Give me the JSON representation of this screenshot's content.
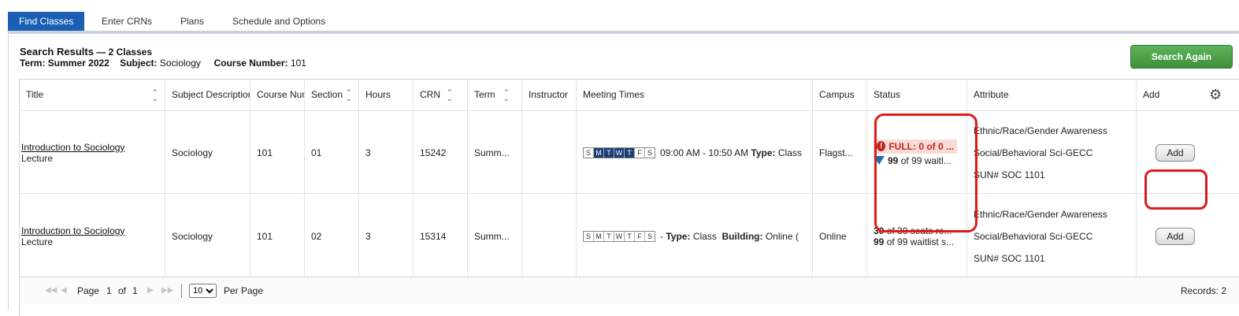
{
  "tabs": [
    "Find Classes",
    "Enter CRNs",
    "Plans",
    "Schedule and Options"
  ],
  "header": {
    "title": "Search Results",
    "count": "— 2 Classes",
    "term_label": "Term:",
    "term_value": "Summer 2022",
    "subject_label": "Subject:",
    "subject_value": "Sociology",
    "course_label": "Course Number:",
    "course_value": "101",
    "search_again": "Search Again"
  },
  "columns": [
    "Title",
    "Subject Description",
    "Course Number",
    "Section",
    "Hours",
    "CRN",
    "Term",
    "Instructor",
    "Meeting Times",
    "Campus",
    "Status",
    "Attribute",
    "Add"
  ],
  "rows": [
    {
      "title": "Introduction to Sociology",
      "type": "Lecture",
      "subject": "Sociology",
      "course": "101",
      "section": "01",
      "hours": "3",
      "crn": "15242",
      "term": "Summ...",
      "instructor": "",
      "days": [
        "S",
        "M",
        "T",
        "W",
        "T",
        "F",
        "S"
      ],
      "days_on": [
        false,
        true,
        true,
        true,
        true,
        false,
        false
      ],
      "time": "09:00 AM - 10:50 AM",
      "meet_type_label": "Type:",
      "meet_type": "Class",
      "building_label": "",
      "building": "",
      "campus": "Flagst...",
      "status_line1": "FULL: 0 of 0 ...",
      "status_line2_num": "99",
      "status_line2_rest": "of 99 waitl...",
      "attributes": [
        "Ethnic/Race/Gender Awareness",
        "Social/Behavioral Sci-GECC",
        "SUN# SOC 1101"
      ],
      "add": "Add"
    },
    {
      "title": "Introduction to Sociology",
      "type": "Lecture",
      "subject": "Sociology",
      "course": "101",
      "section": "02",
      "hours": "3",
      "crn": "15314",
      "term": "Summ...",
      "instructor": "",
      "days": [
        "S",
        "M",
        "T",
        "W",
        "T",
        "F",
        "S"
      ],
      "days_on": [
        false,
        false,
        false,
        false,
        false,
        false,
        false
      ],
      "time": "-",
      "meet_type_label": "Type:",
      "meet_type": "Class",
      "building_label": "Building:",
      "building": "Online (",
      "campus": "Online",
      "status_line1_num": "30",
      "status_line1_rest": "of 30 seats re...",
      "status_line2_num": "99",
      "status_line2_rest": "of 99 waitlist s...",
      "attributes": [
        "Ethnic/Race/Gender Awareness",
        "Social/Behavioral Sci-GECC",
        "SUN# SOC 1101"
      ],
      "add": "Add"
    }
  ],
  "pager": {
    "page_label": "Page",
    "page_num": "1",
    "of_label": "of",
    "total_pages": "1",
    "per_page_value": "10",
    "per_page_label": "Per Page",
    "records": "Records: 2"
  },
  "colors": {
    "tab_active": "#1a5fb4",
    "search_again": "#4aa046",
    "highlight_red": "#e01919",
    "full_red": "#c0241d"
  }
}
